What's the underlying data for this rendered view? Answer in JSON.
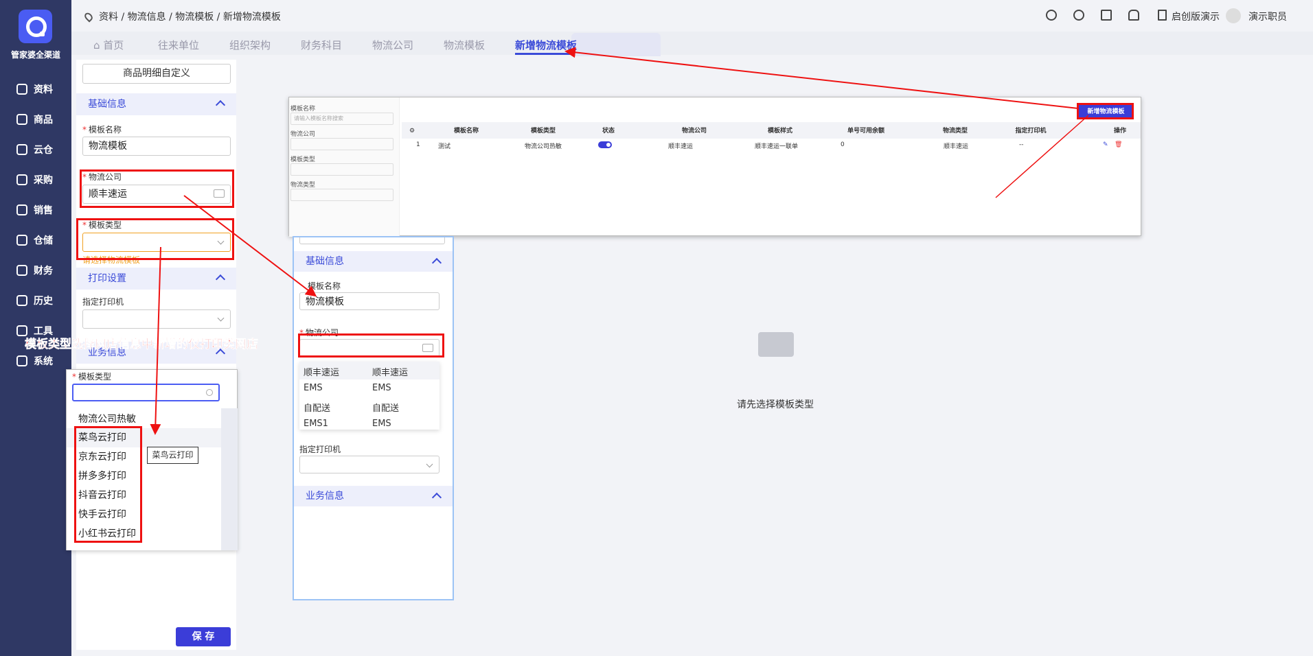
{
  "app": {
    "name": "管家婆全渠道"
  },
  "sidebar": {
    "items": [
      {
        "label": "资料",
        "icon": "layers-icon"
      },
      {
        "label": "商品",
        "icon": "goods-icon"
      },
      {
        "label": "云仓",
        "icon": "cloud-warehouse-icon"
      },
      {
        "label": "采购",
        "icon": "cart-icon"
      },
      {
        "label": "销售",
        "icon": "chart-icon"
      },
      {
        "label": "仓储",
        "icon": "storage-icon"
      },
      {
        "label": "财务",
        "icon": "finance-icon"
      },
      {
        "label": "历史",
        "icon": "history-icon"
      },
      {
        "label": "工具",
        "icon": "tools-icon"
      },
      {
        "label": "系统",
        "icon": "monitor-icon"
      }
    ]
  },
  "header": {
    "breadcrumb": "资料 / 物流信息 / 物流模板 / 新增物流模板",
    "company": "启创版演示",
    "user": "演示职员"
  },
  "tabs": [
    {
      "label": "首页"
    },
    {
      "label": "往来单位"
    },
    {
      "label": "组织架构"
    },
    {
      "label": "财务科目"
    },
    {
      "label": "物流公司"
    },
    {
      "label": "物流模板"
    },
    {
      "label": "新增物流模板"
    }
  ],
  "form": {
    "custom_button": "商品明细自定义",
    "section_basic": "基础信息",
    "template_name_label": "模板名称",
    "template_name_value": "物流模板",
    "logistics_company_label": "物流公司",
    "logistics_company_value": "顺丰速运",
    "template_type_label": "模板类型",
    "template_type_error": "请选择物流模板",
    "section_print": "打印设置",
    "printer_label": "指定打印机",
    "section_business": "业务信息",
    "save_button": "保 存"
  },
  "annotation": "模板类型选择网店信息中新增的仅打印类网店",
  "popup": {
    "label": "模板类型",
    "options": [
      "物流公司热敏",
      "菜鸟云打印",
      "京东云打印",
      "拼多多打印",
      "抖音云打印",
      "快手云打印",
      "小红书云打印"
    ],
    "tooltip": "菜鸟云打印"
  },
  "snapshot": {
    "filter_labels": [
      "模板名称",
      "物流公司",
      "模板类型",
      "物流类型"
    ],
    "filter_placeholder": "请输入模板名称搜索",
    "add_button": "新增物流模板",
    "columns": [
      "模板名称",
      "模板类型",
      "状态",
      "物流公司",
      "模板样式",
      "单号可用余额",
      "物流类型",
      "指定打印机",
      "操作"
    ],
    "row": {
      "index": "1",
      "name": "测试",
      "type": "物流公司热敏",
      "company": "顺丰速运",
      "style": "顺丰速运一联单",
      "balance": "0",
      "logistics_type": "顺丰速运",
      "printer": "--"
    }
  },
  "mid": {
    "section_basic": "基础信息",
    "template_name_label": "模板名称",
    "template_name_value": "物流模板",
    "logistics_company_label": "物流公司",
    "dropdown": [
      [
        "顺丰速运",
        "顺丰速运"
      ],
      [
        "EMS",
        "EMS"
      ],
      [
        "自配送",
        "自配送"
      ],
      [
        "EMS1",
        "EMS"
      ]
    ],
    "printer_label": "指定打印机",
    "section_business": "业务信息"
  },
  "empty": {
    "text": "请先选择模板类型"
  },
  "colors": {
    "sidebar": "#2f3864",
    "primary": "#3b3dd8",
    "annotation": "#e11111"
  }
}
